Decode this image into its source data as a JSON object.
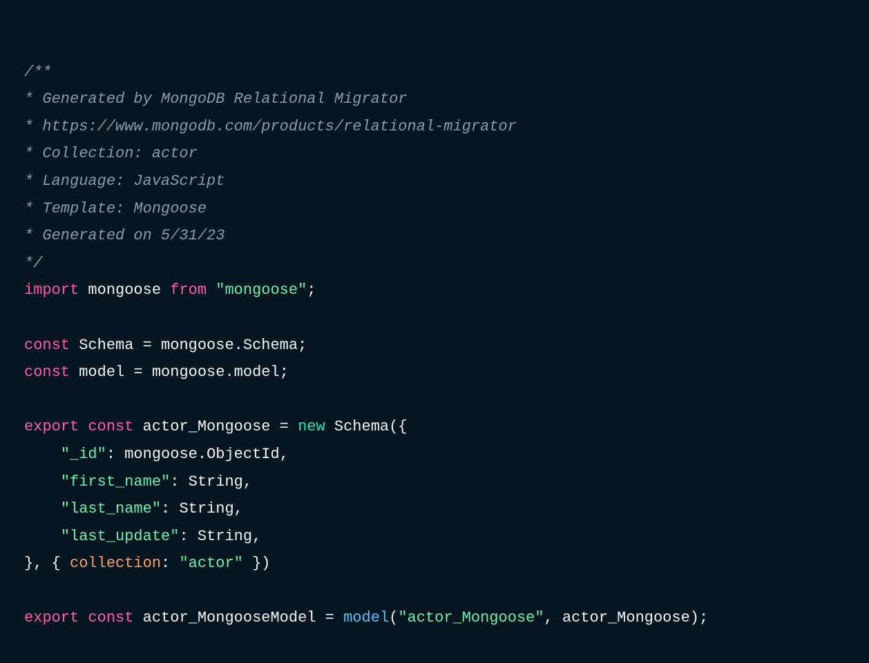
{
  "c1": "/**",
  "c2": "* Generated by MongoDB Relational Migrator",
  "c3": "* https://www.mongodb.com/products/relational-migrator",
  "c4": "* Collection: actor",
  "c5": "* Language: JavaScript",
  "c6": "* Template: Mongoose",
  "c7": "* Generated on 5/31/23",
  "c8": "*/",
  "kw_import": "import",
  "ident_mongoose": "mongoose",
  "kw_from": "from",
  "str_mongoose": "\"mongoose\"",
  "semi": ";",
  "kw_const": "const",
  "ident_Schema": "Schema",
  "eq": " = ",
  "dot": ".",
  "ident_schemaProp": "Schema",
  "ident_model": "model",
  "ident_modelProp": "model",
  "kw_export": "export",
  "ident_actorMongoose": "actor_Mongoose",
  "kw_new": "new",
  "paren_open": "(",
  "brace_open": "{",
  "indent": "    ",
  "str_id": "\"_id\"",
  "colon_sp": ": ",
  "ident_ObjectId": "ObjectId",
  "comma": ",",
  "str_firstname": "\"first_name\"",
  "ident_String": "String",
  "str_lastname": "\"last_name\"",
  "str_lastupdate": "\"last_update\"",
  "brace_close": "}",
  "brace_close_comma": "}, ",
  "prop_collection": "collection",
  "str_actor": "\"actor\"",
  "closing": " })",
  "ident_actorMongooseModel": "actor_MongooseModel",
  "fn_model": "model",
  "str_actorMongoose": "\"actor_Mongoose\"",
  "comma_sp": ", ",
  "paren_close": ")"
}
